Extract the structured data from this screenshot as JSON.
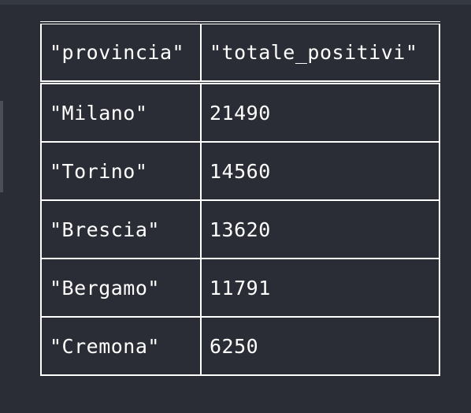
{
  "table": {
    "columns": [
      "\"provincia\"",
      "\"totale_positivi\""
    ],
    "rows": [
      [
        "\"Milano\"",
        "21490"
      ],
      [
        "\"Torino\"",
        "14560"
      ],
      [
        "\"Brescia\"",
        "13620"
      ],
      [
        "\"Bergamo\"",
        "11791"
      ],
      [
        "\"Cremona\"",
        "6250"
      ]
    ]
  }
}
